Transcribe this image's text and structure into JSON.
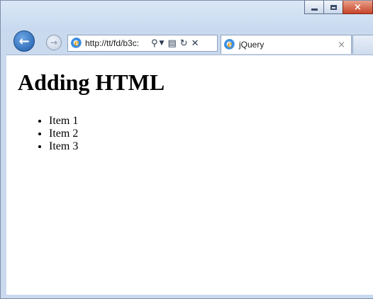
{
  "browser": {
    "url": "http://tt/fd/b3c:",
    "tab_title": "jQuery",
    "tab_close": "×",
    "caption": {
      "minimize": "minimize",
      "maximize": "maximize",
      "close": "×"
    }
  },
  "page": {
    "heading": "Adding HTML",
    "items": [
      "Item 1",
      "Item 2",
      "Item 3"
    ]
  },
  "icons": [
    "back-arrow-icon",
    "forward-arrow-icon",
    "ie-icon",
    "search-icon",
    "dropdown-icon",
    "compatibility-icon",
    "refresh-icon",
    "stop-icon"
  ],
  "colors": {
    "frame": "#c9d9ee",
    "close_button": "#c7442a",
    "back_button": "#1b5aa8"
  }
}
